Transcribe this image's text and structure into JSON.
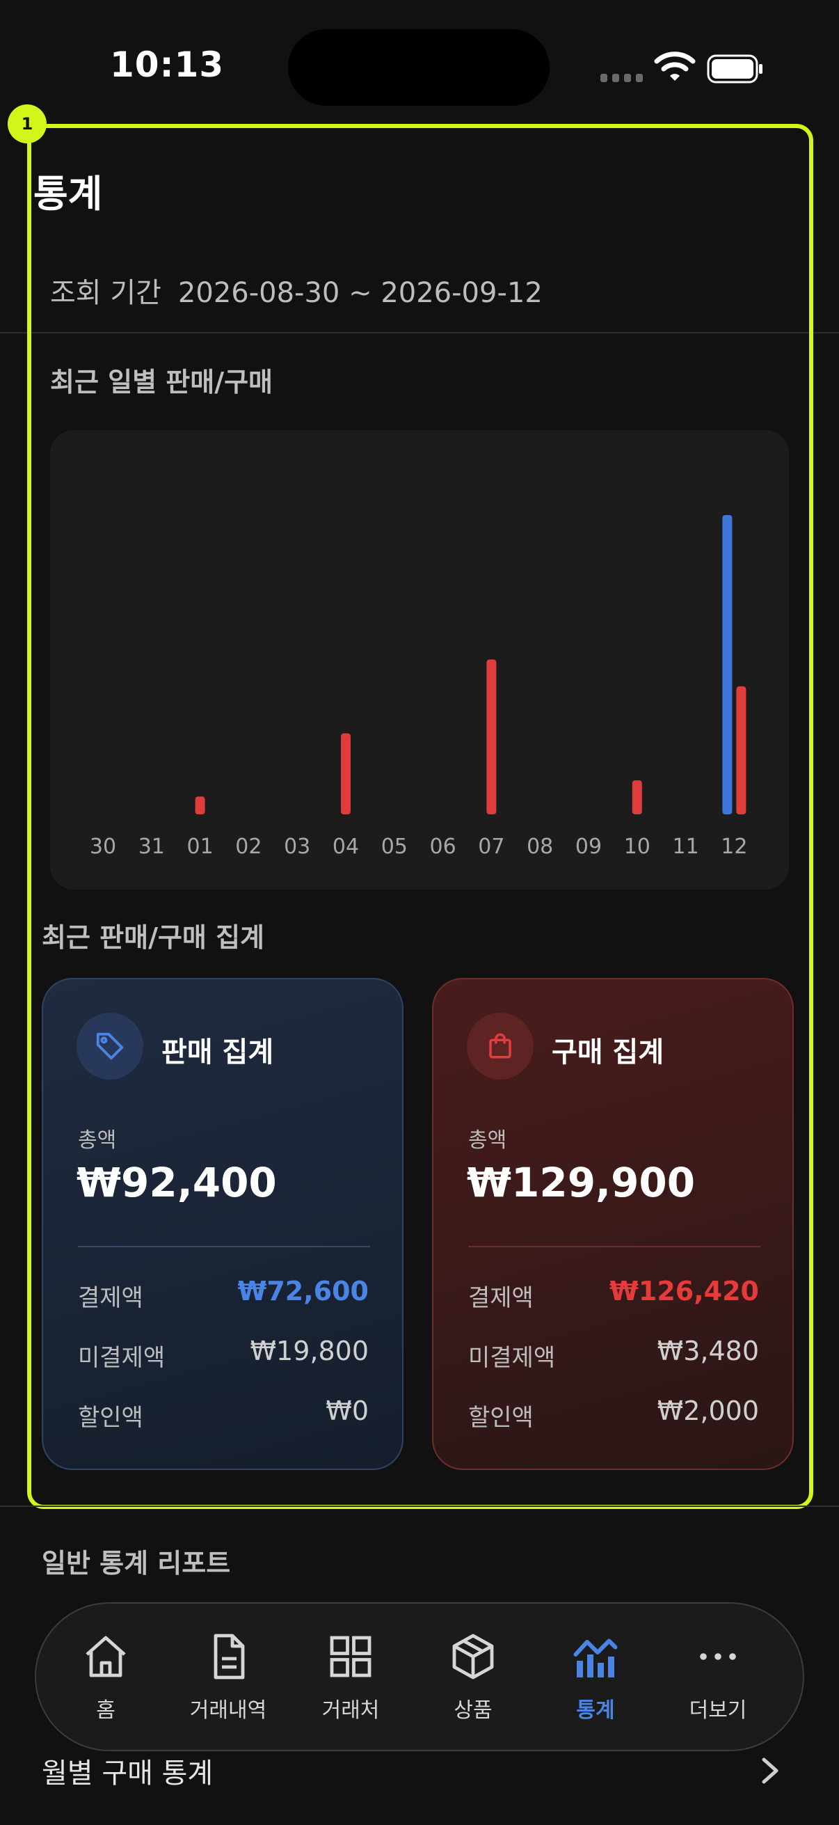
{
  "status_bar": {
    "time": "10:13"
  },
  "highlight": {
    "badge": "1"
  },
  "page": {
    "title": "통계",
    "period_label": "조회 기간",
    "period_value": "2026-08-30 ~ 2026-09-12"
  },
  "daily_section": {
    "title": "최근 일별 판매/구매"
  },
  "chart_data": {
    "type": "bar",
    "categories": [
      "30",
      "31",
      "01",
      "02",
      "03",
      "04",
      "05",
      "06",
      "07",
      "08",
      "09",
      "10",
      "11",
      "12"
    ],
    "series": [
      {
        "values": [
          0,
          0,
          0,
          0,
          0,
          0,
          0,
          0,
          0,
          0,
          0,
          0,
          0,
          92400
        ],
        "color": "#3d78d8"
      },
      {
        "values": [
          0,
          0,
          5500,
          0,
          0,
          25000,
          0,
          0,
          47800,
          0,
          0,
          10500,
          0,
          39500
        ],
        "color": "#e03c3c"
      }
    ],
    "grid": false,
    "legend": "none"
  },
  "summary_section": {
    "title": "최근 판매/구매 집계"
  },
  "sale_summary": {
    "title": "판매 집계",
    "icon": "tag-icon",
    "total_label": "총액",
    "total": "₩92,400",
    "paid_label": "결제액",
    "paid": "₩72,600",
    "unpaid_label": "미결제액",
    "unpaid": "₩19,800",
    "discount_label": "할인액",
    "discount": "₩0"
  },
  "purchase_summary": {
    "title": "구매 집계",
    "icon": "shopping-bag-icon",
    "total_label": "총액",
    "total": "₩129,900",
    "paid_label": "결제액",
    "paid": "₩126,420",
    "unpaid_label": "미결제액",
    "unpaid": "₩3,480",
    "discount_label": "할인액",
    "discount": "₩2,000"
  },
  "report_section": {
    "title": "일반 통계 리포트",
    "items": [
      {
        "label": "월별 구매 통계"
      }
    ]
  },
  "tabbar": {
    "active": "통계",
    "items": [
      {
        "label": "홈",
        "icon": "home-icon"
      },
      {
        "label": "거래내역",
        "icon": "document-icon"
      },
      {
        "label": "거래처",
        "icon": "grid-icon"
      },
      {
        "label": "상품",
        "icon": "box-icon"
      },
      {
        "label": "통계",
        "icon": "chart-icon"
      },
      {
        "label": "더보기",
        "icon": "more-icon"
      }
    ]
  },
  "colors": {
    "accent_blue": "#4a84e4",
    "accent_red": "#e53b3b",
    "highlight": "#d4f51a",
    "background": "#111111"
  }
}
